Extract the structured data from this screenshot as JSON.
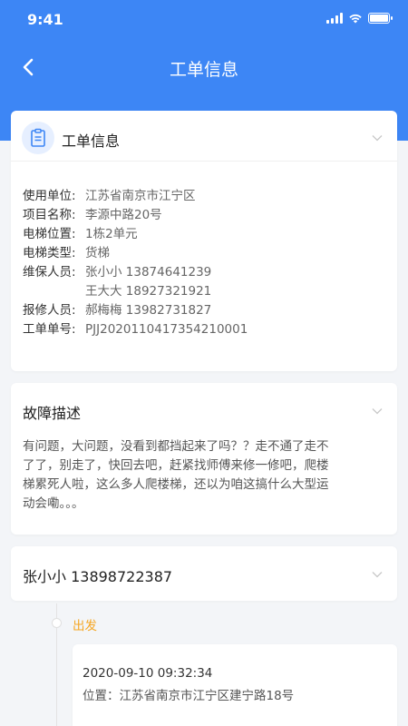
{
  "status_bar": {
    "time": "9:41"
  },
  "nav": {
    "title": "工单信息"
  },
  "info_card": {
    "title": "工单信息",
    "rows": [
      {
        "key": "使用单位:",
        "value": "江苏省南京市江宁区"
      },
      {
        "key": "项目名称:",
        "value": "李源中路20号"
      },
      {
        "key": "电梯位置:",
        "value": "1栋2单元"
      },
      {
        "key": "电梯类型:",
        "value": "货梯"
      },
      {
        "key": "维保人员:",
        "value": "张小小 13874641239"
      },
      {
        "key": "",
        "value": "王大大 18927321921"
      },
      {
        "key": "报修人员:",
        "value": "郝梅梅 13982731827"
      },
      {
        "key": "工单单号:",
        "value": "PJJ2020110417354210001"
      }
    ]
  },
  "fault_card": {
    "title": "故障描述",
    "text": "有问题，大问题，没看到都挡起来了吗？？走不通了走不了了，别走了，快回去吧，赶紧找师傅来修一修吧，爬楼梯累死人啦，这么多人爬楼梯，还以为咱这搞什么大型运动会嘞。。。"
  },
  "person_card": {
    "title": "张小小 13898722387"
  },
  "timeline": [
    {
      "status": "出发",
      "time": "2020-09-10 09:32:34",
      "location": "位置：江苏省南京市江宁区建宁路18号"
    }
  ],
  "colors": {
    "primary": "#3d86f5",
    "status_orange": "#f5a623",
    "background": "#f3f5f8"
  }
}
